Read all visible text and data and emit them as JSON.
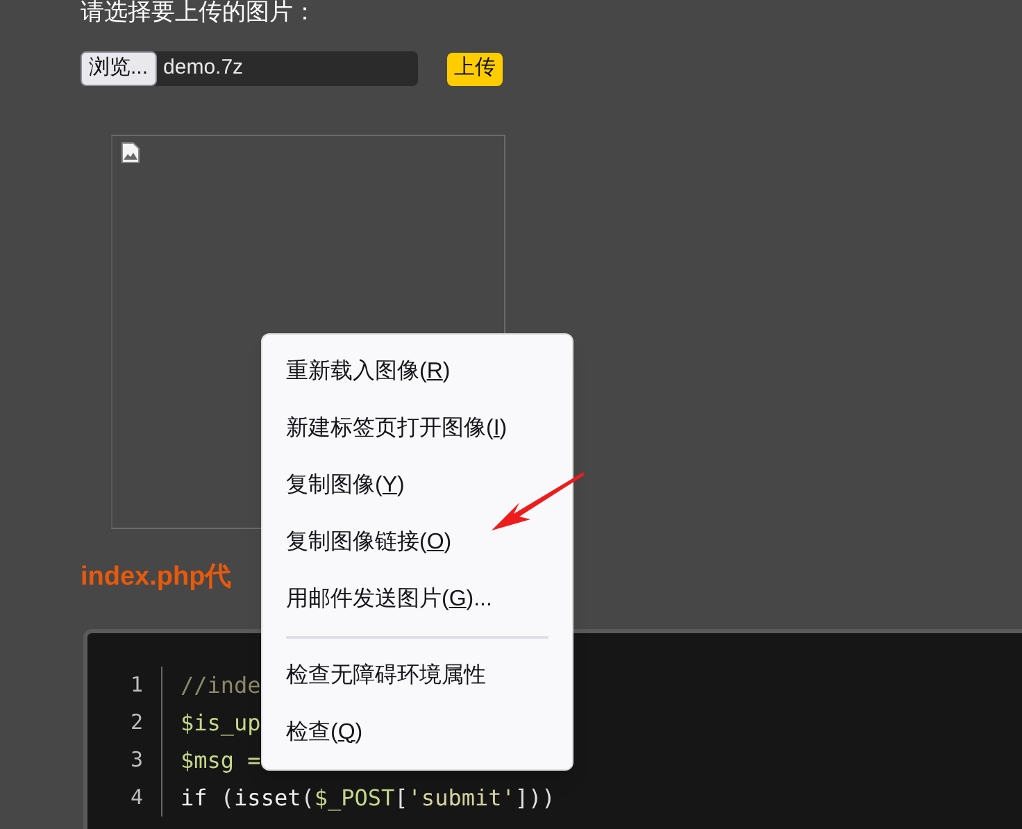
{
  "prompt": "请选择要上传的图片：",
  "file_input": {
    "browse_label": "浏览...",
    "value": "demo.7z"
  },
  "upload_button": "上传",
  "image": {
    "kind": "broken"
  },
  "section_heading": "index.php代",
  "code": {
    "lines": [
      {
        "number": "1",
        "parts": [
          {
            "kind": "comment",
            "text": "//inde"
          }
        ]
      },
      {
        "number": "2",
        "parts": [
          {
            "kind": "var",
            "text": "$is_up"
          }
        ]
      },
      {
        "number": "3",
        "parts": [
          {
            "kind": "var",
            "text": "$msg ="
          }
        ]
      },
      {
        "number": "4",
        "parts": [
          {
            "kind": "keyword",
            "text": "if "
          },
          {
            "kind": "plain",
            "text": "("
          },
          {
            "kind": "keyword",
            "text": "isset"
          },
          {
            "kind": "plain",
            "text": "("
          },
          {
            "kind": "var",
            "text": "$_POST"
          },
          {
            "kind": "plain",
            "text": "["
          },
          {
            "kind": "string",
            "text": "'submit'"
          },
          {
            "kind": "plain",
            "text": "]))"
          }
        ]
      }
    ]
  },
  "context_menu": {
    "items": [
      {
        "kind": "item",
        "before": "重新载入图像(",
        "key": "R",
        "after": ")"
      },
      {
        "kind": "item",
        "before": "新建标签页打开图像(",
        "key": "I",
        "after": ")"
      },
      {
        "kind": "item",
        "before": "复制图像(",
        "key": "Y",
        "after": ")"
      },
      {
        "kind": "item",
        "before": "复制图像链接(",
        "key": "O",
        "after": ")"
      },
      {
        "kind": "item",
        "before": "用邮件发送图片(",
        "key": "G",
        "after": ")..."
      },
      {
        "kind": "separator"
      },
      {
        "kind": "item",
        "before": "检查无障碍环境属性"
      },
      {
        "kind": "item",
        "before": "检查(",
        "key": "Q",
        "after": ")"
      }
    ]
  }
}
